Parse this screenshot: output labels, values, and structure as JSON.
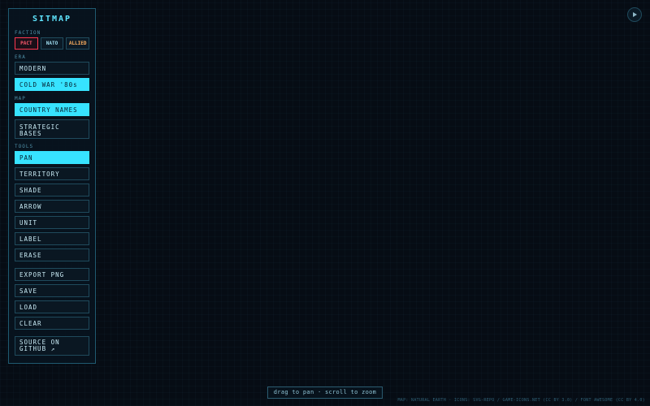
{
  "app": {
    "title": "SITMAP"
  },
  "faction": {
    "label": "FACTION",
    "options": [
      "PACT",
      "NATO",
      "ALLIED"
    ],
    "selected": "PACT"
  },
  "era": {
    "label": "ERA",
    "options": [
      "MODERN",
      "COLD WAR '80s"
    ],
    "selected": "COLD WAR '80s"
  },
  "map": {
    "label": "MAP",
    "options": [
      "COUNTRY NAMES",
      "STRATEGIC BASES"
    ],
    "active": [
      "COUNTRY NAMES"
    ]
  },
  "tools": {
    "label": "TOOLS",
    "options": [
      "PAN",
      "TERRITORY",
      "SHADE",
      "ARROW",
      "UNIT",
      "LABEL",
      "ERASE"
    ],
    "selected": "PAN"
  },
  "actions": [
    "EXPORT PNG",
    "SAVE",
    "LOAD",
    "CLEAR"
  ],
  "source_link": "SOURCE ON GITHUB ↗",
  "hint": "drag to pan · scroll to zoom",
  "credits": "MAP: NATURAL EARTH · ICONS: SVG-REPO / GAME-ICONS.NET (CC BY 3.0) / FONT AWESOME (CC BY 4.0)",
  "colors": {
    "accent": "#37e3ff",
    "pact": "#ff3850",
    "allied": "#ffb060",
    "background": "#060c14"
  },
  "icons": {
    "play": "play-icon"
  }
}
